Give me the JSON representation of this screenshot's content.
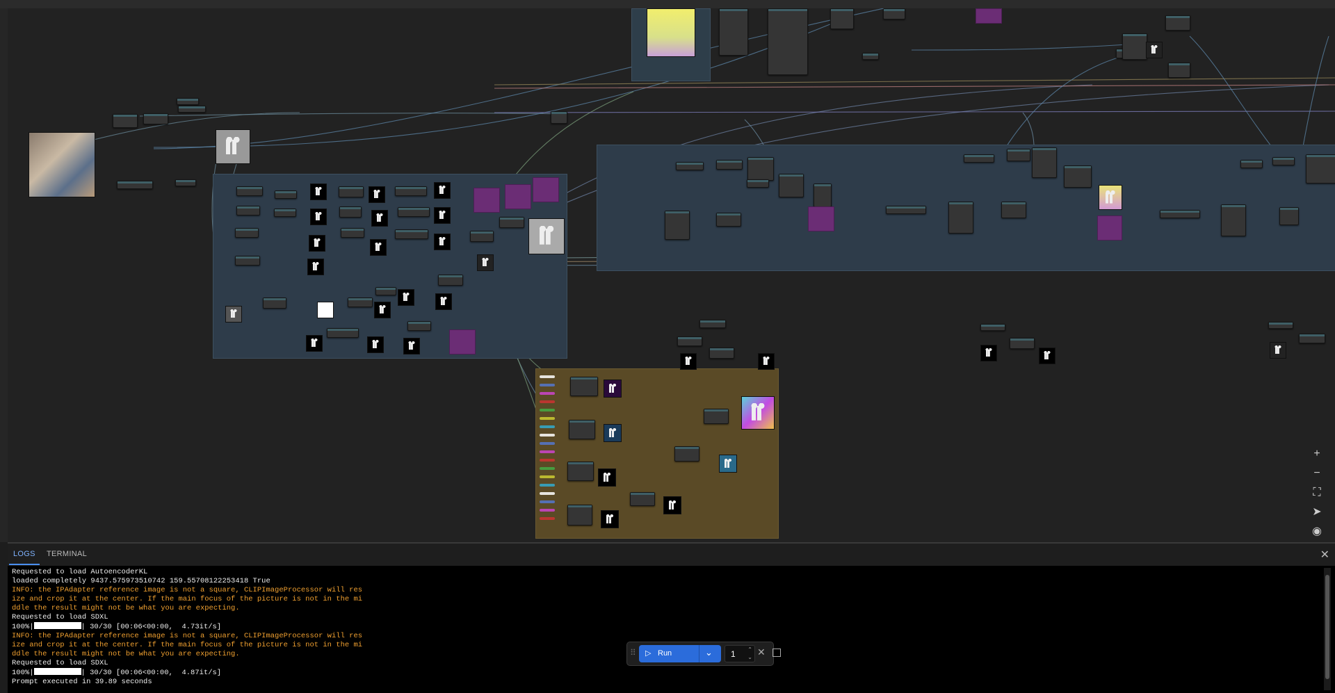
{
  "panel": {
    "tabs": [
      "LOGS",
      "TERMINAL"
    ],
    "log_lines": [
      {
        "text": "Requested to load AutoencoderKL",
        "kind": "normal"
      },
      {
        "text": "loaded completely 9437.575973510742 159.55708122253418 True",
        "kind": "normal"
      },
      {
        "text": "INFO: the IPAdapter reference image is not a square, CLIPImageProcessor will res",
        "kind": "warn"
      },
      {
        "text": "ize and crop it at the center. If the main focus of the picture is not in the mi",
        "kind": "warn"
      },
      {
        "text": "ddle the result might not be what you are expecting.",
        "kind": "warn"
      },
      {
        "text": "Requested to load SDXL",
        "kind": "normal"
      },
      {
        "text": "100%|",
        "suffix": "| 30/30 [00:06<00:00,  4.73it/s]",
        "kind": "progress"
      },
      {
        "text": "INFO: the IPAdapter reference image is not a square, CLIPImageProcessor will res",
        "kind": "warn"
      },
      {
        "text": "ize and crop it at the center. If the main focus of the picture is not in the mi",
        "kind": "warn"
      },
      {
        "text": "ddle the result might not be what you are expecting.",
        "kind": "warn"
      },
      {
        "text": "Requested to load SDXL",
        "kind": "normal"
      },
      {
        "text": "100%|",
        "suffix": "| 30/30 [00:06<00:00,  4.87it/s]",
        "kind": "progress"
      },
      {
        "text": "Prompt executed in 39.89 seconds",
        "kind": "normal"
      }
    ],
    "progress_fraction": 1.0
  },
  "runbar": {
    "run_label": "Run",
    "batch_count": "1"
  },
  "icons": {
    "zoom_in": "+",
    "zoom_out": "−",
    "fit_view": "⛶",
    "locate": "➤",
    "toggle_links": "◉",
    "close": "✕",
    "play": "▷",
    "chevron": "⌄",
    "drag": "⠿",
    "cancel": "✕"
  },
  "colors": {
    "group_blue": "#2e3c4a",
    "group_brown": "#5a4a26",
    "accent_blue": "#2b6cdb",
    "warn_orange": "#f0a030",
    "purple_node": "#6b2d75"
  }
}
